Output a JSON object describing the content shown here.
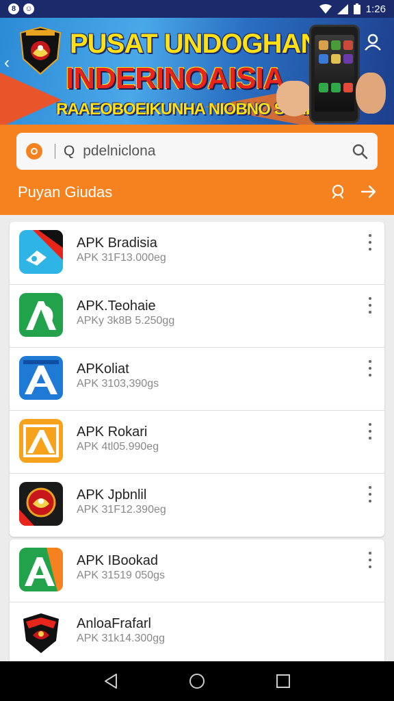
{
  "status_bar": {
    "time": "1:26",
    "left_icons": [
      "app-notification-icon",
      "messenger-icon"
    ],
    "right_icons": [
      "wifi-icon",
      "signal-icon",
      "battery-icon"
    ]
  },
  "banner": {
    "title_line1": "PUSAT UNDOGHAN",
    "title_line2": "INDERINOAISIA",
    "subtitle": "RAAEOBOEIKUNHA NIOBNO SSRK!"
  },
  "search": {
    "value": "pdelniclona",
    "prefix": "Q"
  },
  "section": {
    "title": "Puyan Giudas"
  },
  "apps": [
    {
      "name": "APK Bradisia",
      "meta": "APK 31F13.000eg",
      "icon": "blue-wave-app-icon"
    },
    {
      "name": "APK.Teohaie",
      "meta": "APKy 3k8B 5.250gg",
      "icon": "green-a-app-icon"
    },
    {
      "name": "APKoliat",
      "meta": "APK 3103,390gs",
      "icon": "blue-a-app-icon"
    },
    {
      "name": "APK Rokari",
      "meta": "APK 4tl05.990eg",
      "icon": "orange-a-app-icon"
    },
    {
      "name": "APK Jpbnlil",
      "meta": "APK 31F12.390eg",
      "icon": "emblem-app-icon"
    },
    {
      "name": "APK IBookad",
      "meta": "APK 31519 050gs",
      "icon": "green-orange-a-app-icon"
    },
    {
      "name": "AnloaFrafarl",
      "meta": "APK 31k14.300gg",
      "icon": "red-emblem-app-icon"
    }
  ],
  "colors": {
    "status_bar": "#1b2a6b",
    "accent": "#f5821f",
    "nav_bar": "#000000"
  }
}
